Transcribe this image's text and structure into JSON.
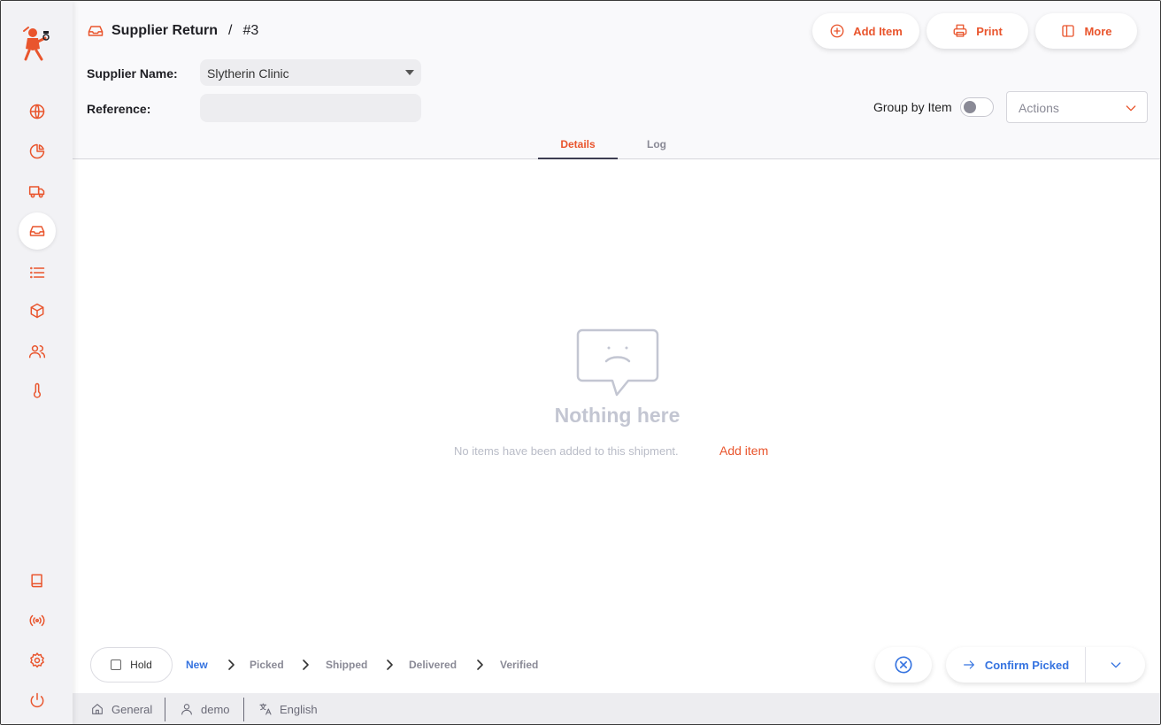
{
  "colors": {
    "accent": "#e9552d",
    "primary": "#3573e0",
    "muted": "#8a8a96"
  },
  "sidebar": {
    "logo": "app-logo",
    "items": [
      {
        "name": "globe-icon"
      },
      {
        "name": "pie-chart-icon"
      },
      {
        "name": "truck-icon"
      },
      {
        "name": "inbox-icon",
        "active": true
      },
      {
        "name": "list-icon"
      },
      {
        "name": "cube-icon"
      },
      {
        "name": "users-icon"
      },
      {
        "name": "thermometer-icon"
      },
      {
        "name": "book-icon"
      },
      {
        "name": "broadcast-icon"
      },
      {
        "name": "gear-icon"
      },
      {
        "name": "power-icon"
      }
    ]
  },
  "header": {
    "title": "Supplier Return",
    "separator": "/",
    "number": "#3",
    "buttons": {
      "add_item": "Add Item",
      "print": "Print",
      "more": "More"
    },
    "supplier_label": "Supplier Name:",
    "supplier_value": "Slytherin Clinic",
    "reference_label": "Reference:",
    "reference_value": "",
    "group_by_label": "Group by Item",
    "group_by_on": false,
    "actions_placeholder": "Actions",
    "tabs": [
      {
        "label": "Details",
        "active": true
      },
      {
        "label": "Log",
        "active": false
      }
    ]
  },
  "empty": {
    "title": "Nothing here",
    "message": "No items have been added to this shipment.",
    "link": "Add item"
  },
  "footer": {
    "hold_label": "Hold",
    "steps": [
      "New",
      "Picked",
      "Shipped",
      "Delivered",
      "Verified"
    ],
    "current_step": "New",
    "confirm_label": "Confirm Picked"
  },
  "statusbar": {
    "store": "General",
    "user": "demo",
    "language": "English"
  }
}
